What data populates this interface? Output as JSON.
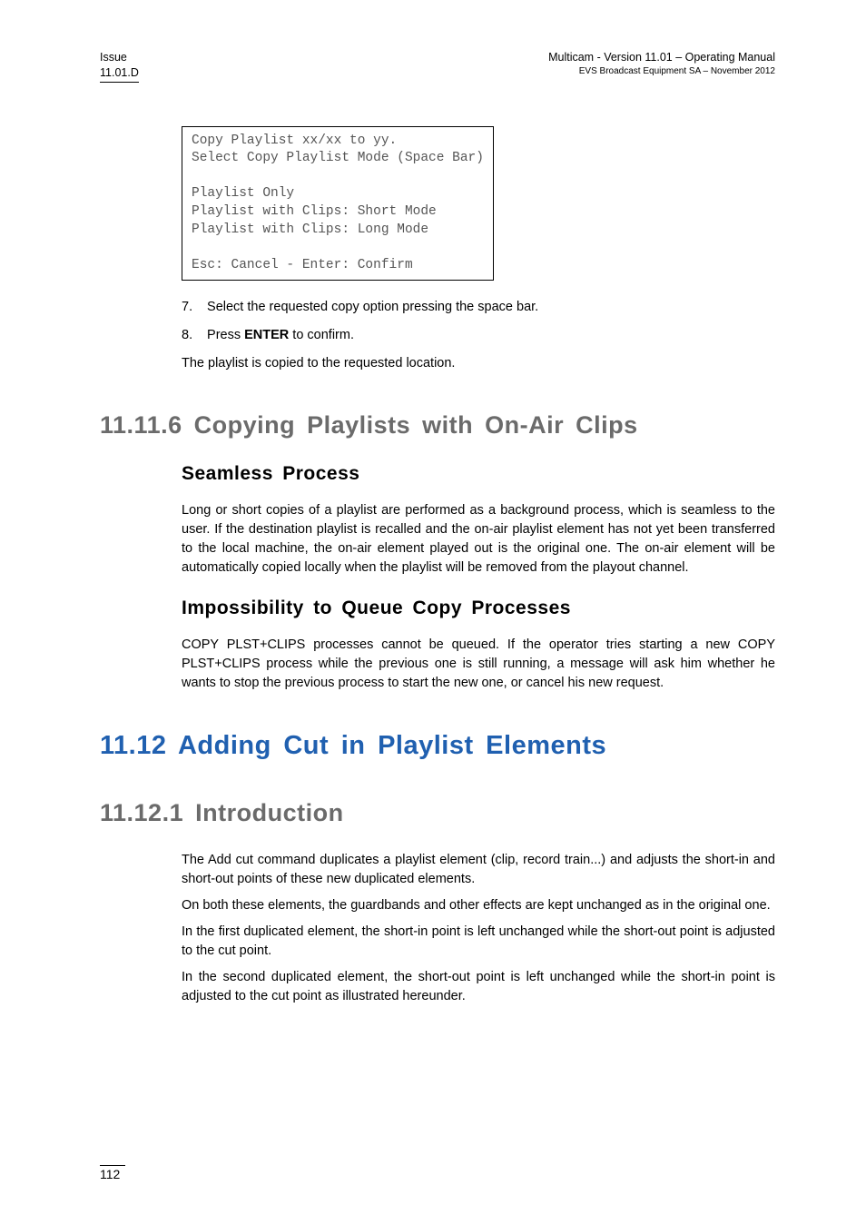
{
  "header": {
    "issue_label": "Issue",
    "issue_value": "11.01.D",
    "right_line1": "Multicam - Version 11.01 – Operating Manual",
    "right_line2": "EVS Broadcast Equipment SA – November 2012"
  },
  "code_box": {
    "l1": "Copy Playlist xx/xx to yy.",
    "l2": "Select Copy Playlist Mode (Space Bar)",
    "l3": "",
    "l4": "Playlist Only",
    "l5": "Playlist with Clips: Short Mode",
    "l6": "Playlist with Clips: Long Mode",
    "l7": "",
    "l8": "Esc: Cancel - Enter: Confirm"
  },
  "steps": {
    "s7_num": "7.",
    "s7_text": "Select the requested copy option pressing the space bar.",
    "s8_num": "8.",
    "s8_pre": "Press ",
    "s8_key": "ENTER",
    "s8_post": " to confirm."
  },
  "copied_line": "The playlist is copied to the requested location.",
  "h_11_11_6": "11.11.6  Copying  Playlists  with  On-Air  Clips",
  "seamless": {
    "title": "Seamless  Process",
    "p": "Long or short copies of a playlist are performed as a background process, which is seamless to the user. If the destination playlist is recalled and the on-air playlist element has not yet been transferred to the local machine, the on-air element played out is the original one. The on-air element will be automatically copied locally when the playlist will be removed from the playout channel."
  },
  "impossibility": {
    "title": "Impossibility  to  Queue  Copy  Processes",
    "p": "COPY PLST+CLIPS processes cannot be queued. If the operator tries starting a new COPY PLST+CLIPS process while the previous one is still running, a message will ask him whether he wants to stop the previous process to start the new one, or cancel his new request."
  },
  "h_11_12": "11.12 Adding  Cut  in  Playlist  Elements",
  "h_11_12_1": "11.12.1  Introduction",
  "intro": {
    "p1": "The Add cut command duplicates a playlist element (clip, record train...) and adjusts the short-in and short-out points of these new duplicated elements.",
    "p2": "On both these elements, the guardbands and other effects are kept unchanged as in the original one.",
    "p3": "In the first duplicated element, the short-in point is left unchanged while the short-out point is adjusted to the cut point.",
    "p4": "In the second duplicated element, the short-out point is left unchanged while the short-in point is adjusted to the cut point as illustrated hereunder."
  },
  "page_number": "112"
}
